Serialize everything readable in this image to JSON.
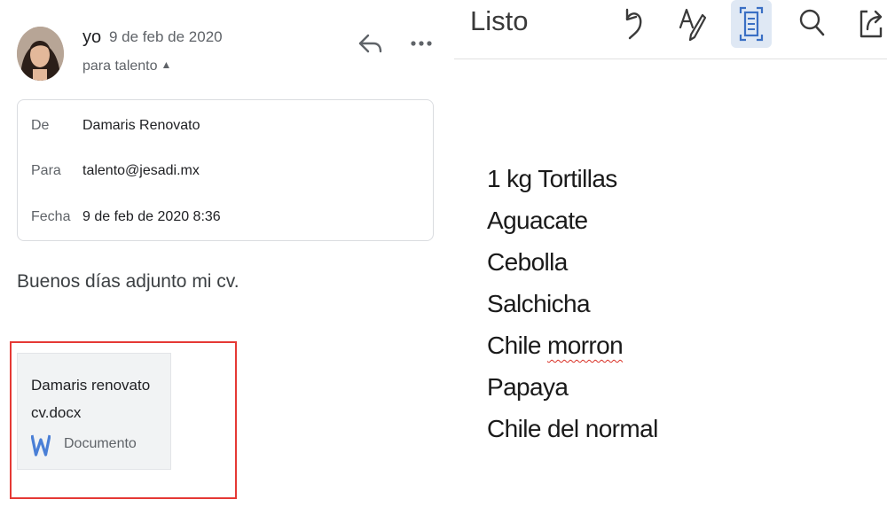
{
  "email": {
    "sender": "yo",
    "date": "9 de feb de 2020",
    "to_summary": "para talento",
    "details": [
      {
        "key": "De",
        "value": "Damaris Renovato"
      },
      {
        "key": "Para",
        "value": "talento@jesadi.mx"
      },
      {
        "key": "Fecha",
        "value": "9 de feb de 2020 8:36"
      }
    ],
    "body": "Buenos días adjunto mi cv.",
    "attachment": {
      "name": "Damaris renovato cv.docx",
      "type": "Documento",
      "icon": "word-icon"
    }
  },
  "notes": {
    "done_label": "Listo",
    "toolbar_icons": [
      "undo-icon",
      "pen-icon",
      "document-scan-icon",
      "search-icon",
      "share-icon"
    ],
    "lines": [
      {
        "text": "1 kg Tortillas"
      },
      {
        "text": "Aguacate"
      },
      {
        "text": "Cebolla"
      },
      {
        "text": "Salchicha"
      },
      {
        "text": "Chile ",
        "misspelled": "morron"
      },
      {
        "text": "Papaya"
      },
      {
        "text": "Chile del normal"
      }
    ]
  },
  "colors": {
    "highlight_border": "#e53935",
    "spellcheck": "#d93025",
    "word_blue": "#4a7fd6",
    "active_button": "#dfe8f4"
  }
}
